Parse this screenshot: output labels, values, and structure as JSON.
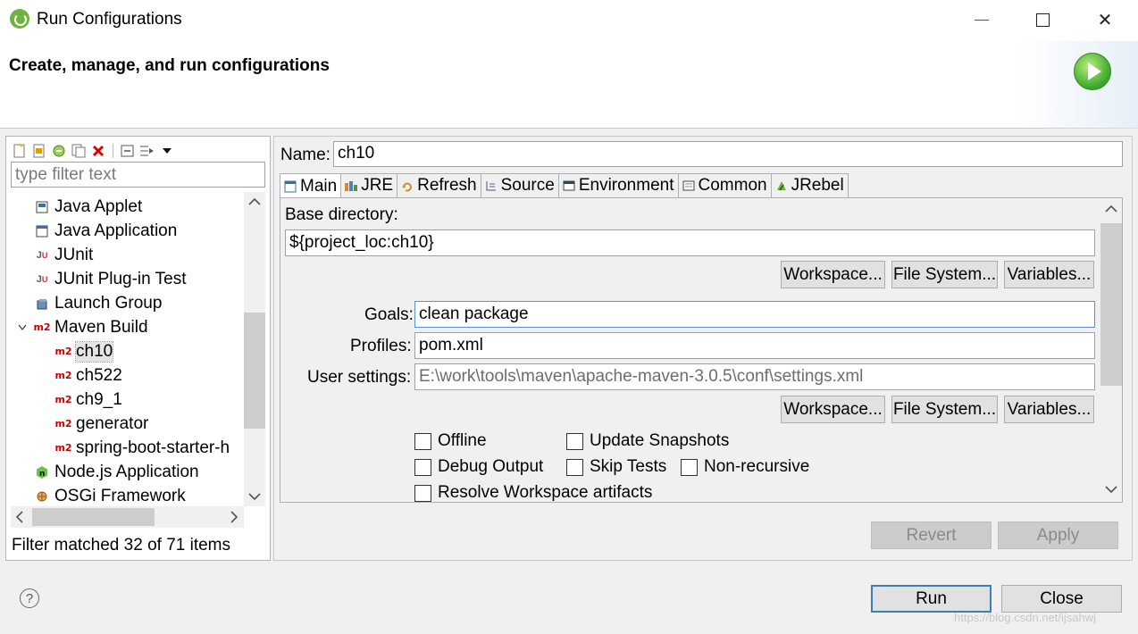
{
  "window": {
    "title": "Run Configurations",
    "min_glyph": "",
    "max_glyph": "",
    "close_glyph": "✕"
  },
  "banner": {
    "title": "Create, manage, and run configurations"
  },
  "left": {
    "filter_placeholder": "type filter text",
    "tree": [
      {
        "label": "Java Applet",
        "icon": "java-applet-icon",
        "level": 0
      },
      {
        "label": "Java Application",
        "icon": "java-application-icon",
        "level": 0
      },
      {
        "label": "JUnit",
        "icon": "junit-icon",
        "level": 0
      },
      {
        "label": "JUnit Plug-in Test",
        "icon": "junit-plugin-icon",
        "level": 0
      },
      {
        "label": "Launch Group",
        "icon": "launch-group-icon",
        "level": 0
      },
      {
        "label": "Maven Build",
        "icon": "maven-icon",
        "level": 0,
        "expanded": true
      },
      {
        "label": "ch10",
        "icon": "maven-icon",
        "level": 1,
        "selected": true
      },
      {
        "label": "ch522",
        "icon": "maven-icon",
        "level": 1
      },
      {
        "label": "ch9_1",
        "icon": "maven-icon",
        "level": 1
      },
      {
        "label": "generator",
        "icon": "maven-icon",
        "level": 1
      },
      {
        "label": "spring-boot-starter-h",
        "icon": "maven-icon",
        "level": 1
      },
      {
        "label": "Node.js Application",
        "icon": "nodejs-icon",
        "level": 0
      },
      {
        "label": "OSGi Framework",
        "icon": "osgi-icon",
        "level": 0
      }
    ],
    "status": "Filter matched 32 of 71 items"
  },
  "right": {
    "name_label": "Name:",
    "name_value": "ch10",
    "tabs": [
      {
        "label": "Main",
        "icon": "main-tab-icon",
        "active": true
      },
      {
        "label": "JRE",
        "icon": "jre-icon"
      },
      {
        "label": "Refresh",
        "icon": "refresh-icon"
      },
      {
        "label": "Source",
        "icon": "source-icon"
      },
      {
        "label": "Environment",
        "icon": "environment-icon"
      },
      {
        "label": "Common",
        "icon": "common-icon"
      },
      {
        "label": "JRebel",
        "icon": "jrebel-icon"
      }
    ],
    "main": {
      "base_dir_label": "Base directory:",
      "base_dir_value": "${project_loc:ch10}",
      "workspace_btn": "Workspace...",
      "filesystem_btn": "File System...",
      "variables_btn": "Variables...",
      "goals_label": "Goals:",
      "goals_value": "clean package",
      "profiles_label": "Profiles:",
      "profiles_value": "pom.xml",
      "user_settings_label": "User settings:",
      "user_settings_value": "E:\\work\\tools\\maven\\apache-maven-3.0.5\\conf\\settings.xml",
      "workspace_btn2": "Workspace...",
      "filesystem_btn2": "File System...",
      "variables_btn2": "Variables...",
      "offline": "Offline",
      "update_snapshots": "Update Snapshots",
      "debug_output": "Debug Output",
      "skip_tests": "Skip Tests",
      "non_recursive": "Non-recursive",
      "resolve_workspace": "Resolve Workspace artifacts"
    },
    "revert_btn": "Revert",
    "apply_btn": "Apply"
  },
  "footer": {
    "help_glyph": "?",
    "run_btn": "Run",
    "close_btn": "Close",
    "watermark": "https://blog.csdn.net/ijsahwj"
  }
}
